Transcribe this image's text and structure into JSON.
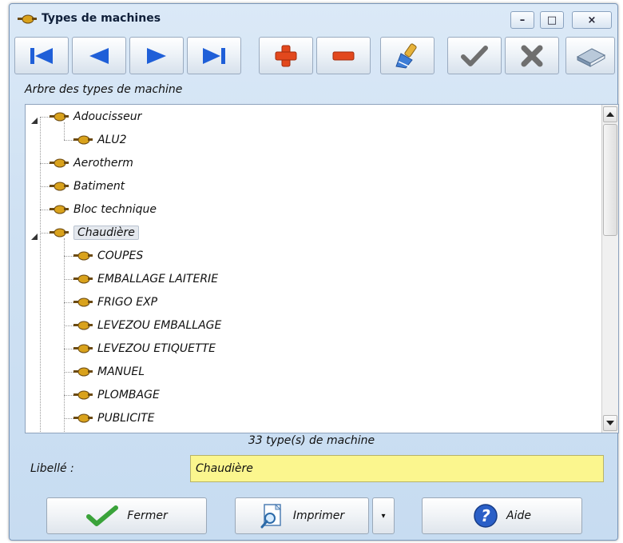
{
  "window": {
    "title": "Types de machines",
    "controls": {
      "minimize": "–",
      "maximize": "□",
      "close": "×"
    }
  },
  "toolbar": {
    "buttons": [
      {
        "name": "first",
        "icon": "first-record-icon",
        "color": "#1f5fd8"
      },
      {
        "name": "previous",
        "icon": "previous-record-icon",
        "color": "#1f5fd8"
      },
      {
        "name": "next",
        "icon": "next-record-icon",
        "color": "#1f5fd8"
      },
      {
        "name": "last",
        "icon": "last-record-icon",
        "color": "#1f5fd8"
      },
      {
        "name": "add",
        "icon": "plus-icon",
        "color": "#e2481d"
      },
      {
        "name": "delete",
        "icon": "minus-icon",
        "color": "#e2481d"
      },
      {
        "name": "edit",
        "icon": "brush-icon",
        "color": "#3d7dd6"
      },
      {
        "name": "validate",
        "icon": "checkmark-icon",
        "color": "#707070"
      },
      {
        "name": "cancel",
        "icon": "cross-icon",
        "color": "#707070"
      },
      {
        "name": "book",
        "icon": "book-icon",
        "color": "#8aa0b8"
      }
    ]
  },
  "tree": {
    "label": "Arbre des types de machine",
    "rows": [
      {
        "text": "Adoucisseur",
        "level": 0,
        "expanded": true
      },
      {
        "text": "ALU2",
        "level": 1
      },
      {
        "text": "Aerotherm",
        "level": 0
      },
      {
        "text": "Batiment",
        "level": 0
      },
      {
        "text": "Bloc technique",
        "level": 0
      },
      {
        "text": "Chaudière",
        "level": 0,
        "expanded": true,
        "selected": true
      },
      {
        "text": "COUPES",
        "level": 1
      },
      {
        "text": "EMBALLAGE LAITERIE",
        "level": 1
      },
      {
        "text": "FRIGO EXP",
        "level": 1
      },
      {
        "text": "LEVEZOU EMBALLAGE",
        "level": 1
      },
      {
        "text": "LEVEZOU ETIQUETTE",
        "level": 1
      },
      {
        "text": "MANUEL",
        "level": 1
      },
      {
        "text": "PLOMBAGE",
        "level": 1
      },
      {
        "text": "PUBLICITE",
        "level": 1
      }
    ]
  },
  "status": {
    "count_text": "33 type(s) de machine"
  },
  "form": {
    "libelle_label": "Libellé :",
    "libelle_value": "Chaudière",
    "field_color": "#fbf68e"
  },
  "buttons": {
    "fermer": "Fermer",
    "imprimer": "Imprimer",
    "imprimer_dropdown": "▾",
    "aide": "Aide"
  }
}
